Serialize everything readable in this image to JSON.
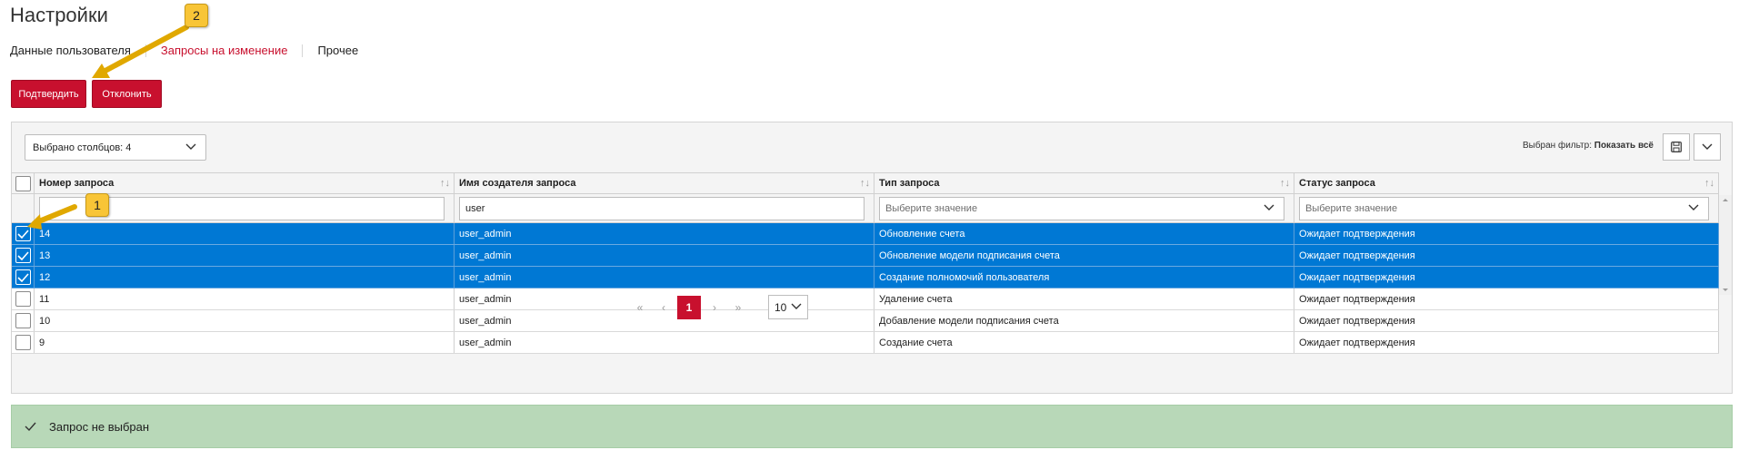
{
  "page": {
    "title": "Настройки"
  },
  "tabs": [
    {
      "label": "Данные пользователя"
    },
    {
      "label": "Запросы на изменение"
    },
    {
      "label": "Прочее"
    }
  ],
  "actions": {
    "confirm": "Подтвердить",
    "reject": "Отклонить"
  },
  "toolbar": {
    "column_selector": "Выбрано столбцов: 4",
    "filter_prefix": "Выбран фильтр:",
    "filter_value": "Показать всё",
    "save_icon": "save-icon",
    "menu_icon": "chevron-down-icon"
  },
  "table": {
    "columns": [
      "Номер запроса",
      "Имя создателя запроса",
      "Тип запроса",
      "Статус запроса"
    ],
    "filters": {
      "number": "",
      "creator": "user",
      "type_placeholder": "Выберите значение",
      "status_placeholder": "Выберите значение"
    },
    "rows": [
      {
        "id": "14",
        "creator": "user_admin",
        "type": "Обновление счета",
        "status": "Ожидает подтверждения",
        "selected": true
      },
      {
        "id": "13",
        "creator": "user_admin",
        "type": "Обновление модели подписания счета",
        "status": "Ожидает подтверждения",
        "selected": true
      },
      {
        "id": "12",
        "creator": "user_admin",
        "type": "Создание полномочий пользователя",
        "status": "Ожидает подтверждения",
        "selected": true
      },
      {
        "id": "11",
        "creator": "user_admin",
        "type": "Удаление счета",
        "status": "Ожидает подтверждения",
        "selected": false
      },
      {
        "id": "10",
        "creator": "user_admin",
        "type": "Добавление модели подписания счета",
        "status": "Ожидает подтверждения",
        "selected": false
      },
      {
        "id": "9",
        "creator": "user_admin",
        "type": "Создание счета",
        "status": "Ожидает подтверждения",
        "selected": false
      }
    ]
  },
  "pagination": {
    "first": "«",
    "prev": "‹",
    "current": "1",
    "next": "›",
    "last": "»",
    "page_size": "10"
  },
  "status_bar": {
    "message": "Запрос не выбран"
  },
  "annotations": {
    "badge1": "1",
    "badge2": "2"
  },
  "colors": {
    "accent": "#c8102e",
    "selection": "#0078d4",
    "status_bg": "#b8d8b8",
    "badge": "#f8c537"
  }
}
